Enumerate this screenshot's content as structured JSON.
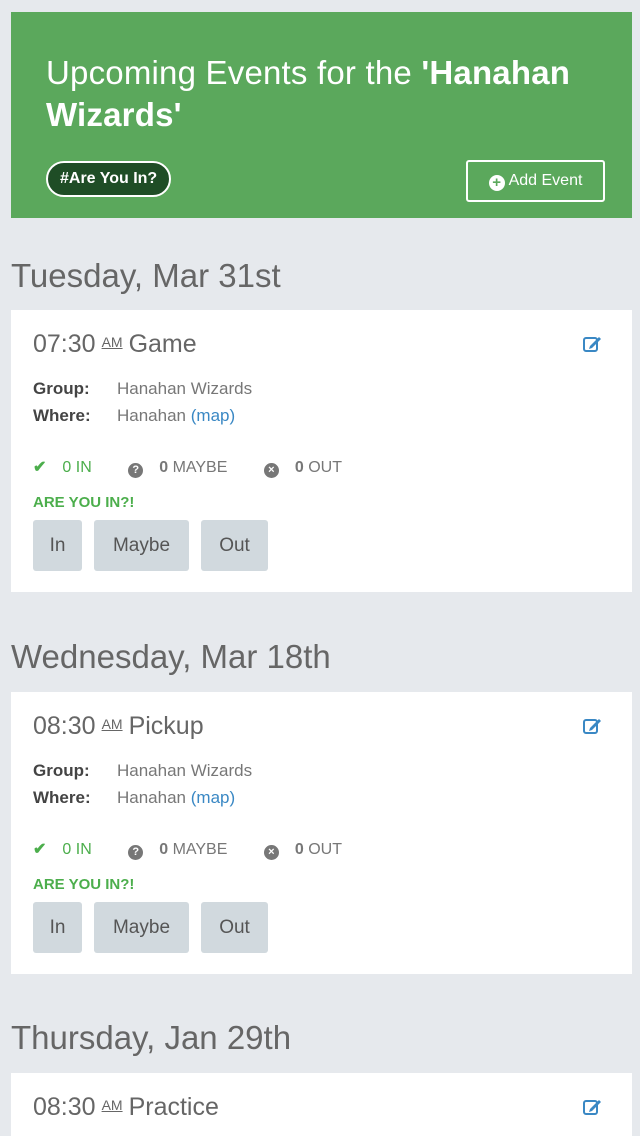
{
  "header": {
    "title_prefix": "Upcoming Events for the ",
    "team_name": "'Hanahan Wizards'",
    "tag_label": "#Are You In?",
    "add_event_label": "Add Event"
  },
  "days": [
    {
      "date_label": "Tuesday, Mar 31st",
      "event": {
        "time": "07:30",
        "ampm": "AM",
        "name": "Game",
        "group_label": "Group:",
        "group": "Hanahan Wizards",
        "where_label": "Where:",
        "where": "Hanahan",
        "map_label": "(map)",
        "in_count": "0 IN",
        "maybe_count": "0",
        "maybe_label": "MAYBE",
        "out_count": "0",
        "out_label": "OUT",
        "prompt": "ARE YOU IN?!",
        "btn_in": "In",
        "btn_maybe": "Maybe",
        "btn_out": "Out"
      }
    },
    {
      "date_label": "Wednesday, Mar 18th",
      "event": {
        "time": "08:30",
        "ampm": "AM",
        "name": "Pickup",
        "group_label": "Group:",
        "group": "Hanahan Wizards",
        "where_label": "Where:",
        "where": "Hanahan",
        "map_label": "(map)",
        "in_count": "0 IN",
        "maybe_count": "0",
        "maybe_label": "MAYBE",
        "out_count": "0",
        "out_label": "OUT",
        "prompt": "ARE YOU IN?!",
        "btn_in": "In",
        "btn_maybe": "Maybe",
        "btn_out": "Out"
      }
    },
    {
      "date_label": "Thursday, Jan 29th",
      "event": {
        "time": "08:30",
        "ampm": "AM",
        "name": "Practice"
      }
    }
  ],
  "colors": {
    "brand_green": "#5ba85c",
    "tag_dark_green": "#1f4d26",
    "link_blue": "#3a88c4",
    "status_green": "#4cae4c",
    "page_bg": "#e6e9ed"
  },
  "icons": {
    "add": "plus-circle-icon",
    "edit": "edit-icon",
    "in": "check-icon",
    "maybe": "question-circle-icon",
    "out": "x-circle-icon"
  }
}
